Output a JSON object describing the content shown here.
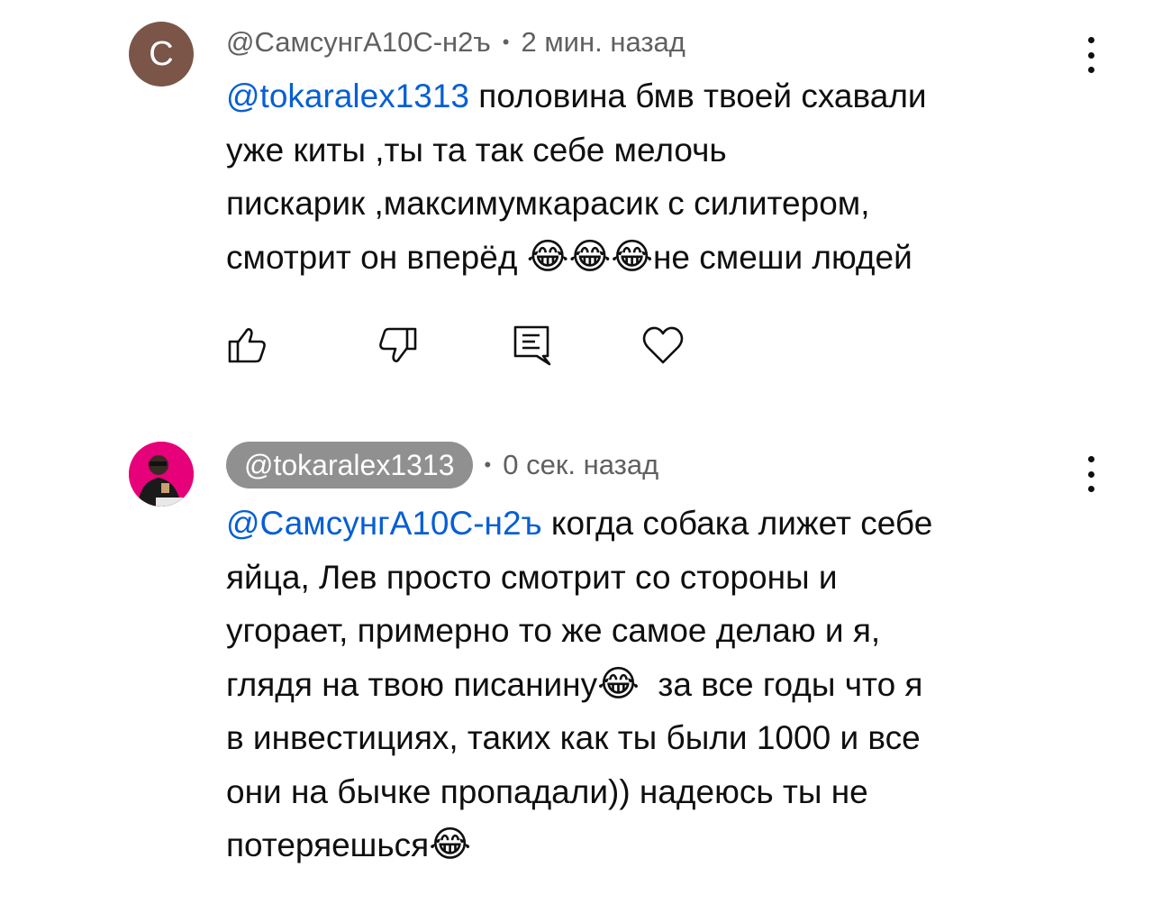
{
  "comments": [
    {
      "author": "@СамсунгА10С-н2ъ",
      "avatar_letter": "С",
      "avatar_color": "#7a5548",
      "separator": "•",
      "time": "2 мин. назад",
      "mention": "@tokaralex1313",
      "text_lines": [
        " половина бмв твоей схавали",
        "уже киты ,ты та так себе  мелочь",
        "пискарик ,максимумкарасик с силитером,",
        "смотрит он вперёд ",
        "не смеши людей"
      ],
      "emoji": "😂",
      "actions": {
        "like": "thumb-up-icon",
        "dislike": "thumb-down-icon",
        "reply": "reply-icon",
        "heart": "heart-icon"
      }
    },
    {
      "author": "@tokaralex1313",
      "author_chip_color": "#909090",
      "avatar_color": "#e6007a",
      "separator": "•",
      "time": "0 сек. назад",
      "mention": "@СамсунгА10С-н2ъ",
      "text_lines": [
        " когда собака лижет себе",
        "яйца, Лев просто смотрит со стороны и",
        "угорает, примерно то же самое делаю и я,",
        "глядя на твою писанину",
        "  за все годы что я",
        "в инвестициях, таких как ты были 1000 и все",
        "они на бычке пропадали)) надеюсь ты не",
        "потеряешься"
      ],
      "emoji": "😂"
    }
  ],
  "colors": {
    "mention": "#065fd4",
    "meta": "#606060",
    "text": "#0f0f0f"
  }
}
